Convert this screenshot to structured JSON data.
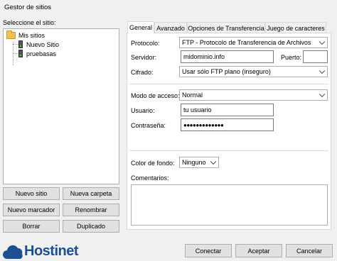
{
  "window": {
    "title": "Gestor de sitios"
  },
  "left": {
    "select_label": "Seleccione el sitio:",
    "tree": {
      "root": "Mis sitios",
      "items": [
        "Nuevo Sitio",
        "pruebasas"
      ]
    },
    "buttons": {
      "new_site": "Nuevo sitio",
      "new_folder": "Nueva carpeta",
      "new_bookmark": "Nuevo marcador",
      "rename": "Renombrar",
      "delete": "Borrar",
      "duplicate": "Duplicado"
    }
  },
  "tabs": [
    "General",
    "Avanzado",
    "Opciones de Transferencia",
    "Juego de caracteres"
  ],
  "general": {
    "protocol_label": "Protocolo:",
    "protocol_value": "FTP - Protocolo de Transferencia de Archivos",
    "server_label": "Servidor:",
    "server_value": "midominio.info",
    "port_label": "Puerto:",
    "port_value": "",
    "encryption_label": "Cifrado:",
    "encryption_value": "Usar sólo FTP plano (inseguro)",
    "access_label": "Modo de acceso:",
    "access_value": "Normal",
    "user_label": "Usuario:",
    "user_value": "tu usuario",
    "password_label": "Contraseña:",
    "password_value": "●●●●●●●●●●●●●",
    "bgcolor_label": "Color de fondo:",
    "bgcolor_value": "Ninguno",
    "comments_label": "Comentarios:"
  },
  "footer": {
    "connect": "Conectar",
    "accept": "Aceptar",
    "cancel": "Cancelar"
  },
  "logo": {
    "text": "Hostinet"
  }
}
